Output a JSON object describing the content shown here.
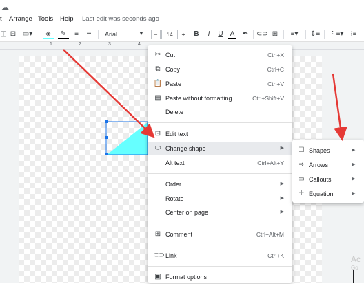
{
  "menubar": {
    "items": [
      "t",
      "Arrange",
      "Tools",
      "Help"
    ],
    "last_edit": "Last edit was seconds ago"
  },
  "toolbar": {
    "font": "Arial",
    "font_size": "14",
    "minus": "−",
    "plus": "+",
    "bold": "B",
    "italic": "I",
    "underline": "U",
    "text_color": "A"
  },
  "ruler": [
    "1",
    "2",
    "3",
    "4"
  ],
  "context_menu": {
    "items": [
      {
        "icon": "cut-icon",
        "label": "Cut",
        "shortcut": "Ctrl+X"
      },
      {
        "icon": "copy-icon",
        "label": "Copy",
        "shortcut": "Ctrl+C"
      },
      {
        "icon": "paste-icon",
        "label": "Paste",
        "shortcut": "Ctrl+V"
      },
      {
        "icon": "paste-plain-icon",
        "label": "Paste without formatting",
        "shortcut": "Ctrl+Shift+V"
      },
      {
        "icon": "",
        "label": "Delete",
        "shortcut": ""
      },
      {
        "icon": "edit-text-icon",
        "label": "Edit text",
        "shortcut": ""
      },
      {
        "icon": "change-shape-icon",
        "label": "Change shape",
        "shortcut": ""
      },
      {
        "icon": "",
        "label": "Alt text",
        "shortcut": "Ctrl+Alt+Y"
      },
      {
        "icon": "",
        "label": "Order",
        "shortcut": ""
      },
      {
        "icon": "",
        "label": "Rotate",
        "shortcut": ""
      },
      {
        "icon": "",
        "label": "Center on page",
        "shortcut": ""
      },
      {
        "icon": "comment-icon",
        "label": "Comment",
        "shortcut": "Ctrl+Alt+M"
      },
      {
        "icon": "link-icon",
        "label": "Link",
        "shortcut": "Ctrl+K"
      },
      {
        "icon": "format-options-icon",
        "label": "Format options",
        "shortcut": ""
      }
    ]
  },
  "submenu": {
    "items": [
      {
        "icon": "square-icon",
        "label": "Shapes"
      },
      {
        "icon": "arrow-outline-icon",
        "label": "Arrows"
      },
      {
        "icon": "callout-icon",
        "label": "Callouts"
      },
      {
        "icon": "plus-icon",
        "label": "Equation"
      }
    ]
  },
  "watermark": {
    "line1": "Ac",
    "line2": "Go"
  },
  "colors": {
    "accent_shape": "#66ffff",
    "selection": "#1a73e8",
    "arrow": "#e53935"
  }
}
